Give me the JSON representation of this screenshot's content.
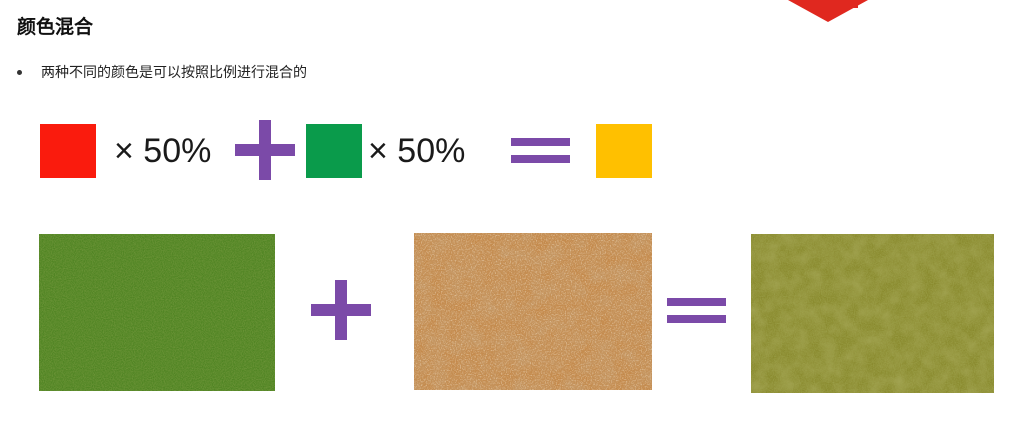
{
  "slide": {
    "title": "颜色混合",
    "bullet": "两种不同的颜色是可以按照比例进行混合的"
  },
  "color_mix": {
    "first": {
      "color": "#fa1b0d",
      "ratio_label": "× 50%"
    },
    "second": {
      "color": "#0a9b4b",
      "ratio_label": "× 50%"
    },
    "result": {
      "color": "#ffc000"
    },
    "operator_color": "#7b4aa8"
  },
  "texture_mix": {
    "inputs": [
      "grass-texture",
      "dirt-texture"
    ],
    "output": "mixed-grass-dirt-texture"
  },
  "icons": [
    "plus-icon",
    "equals-icon"
  ]
}
